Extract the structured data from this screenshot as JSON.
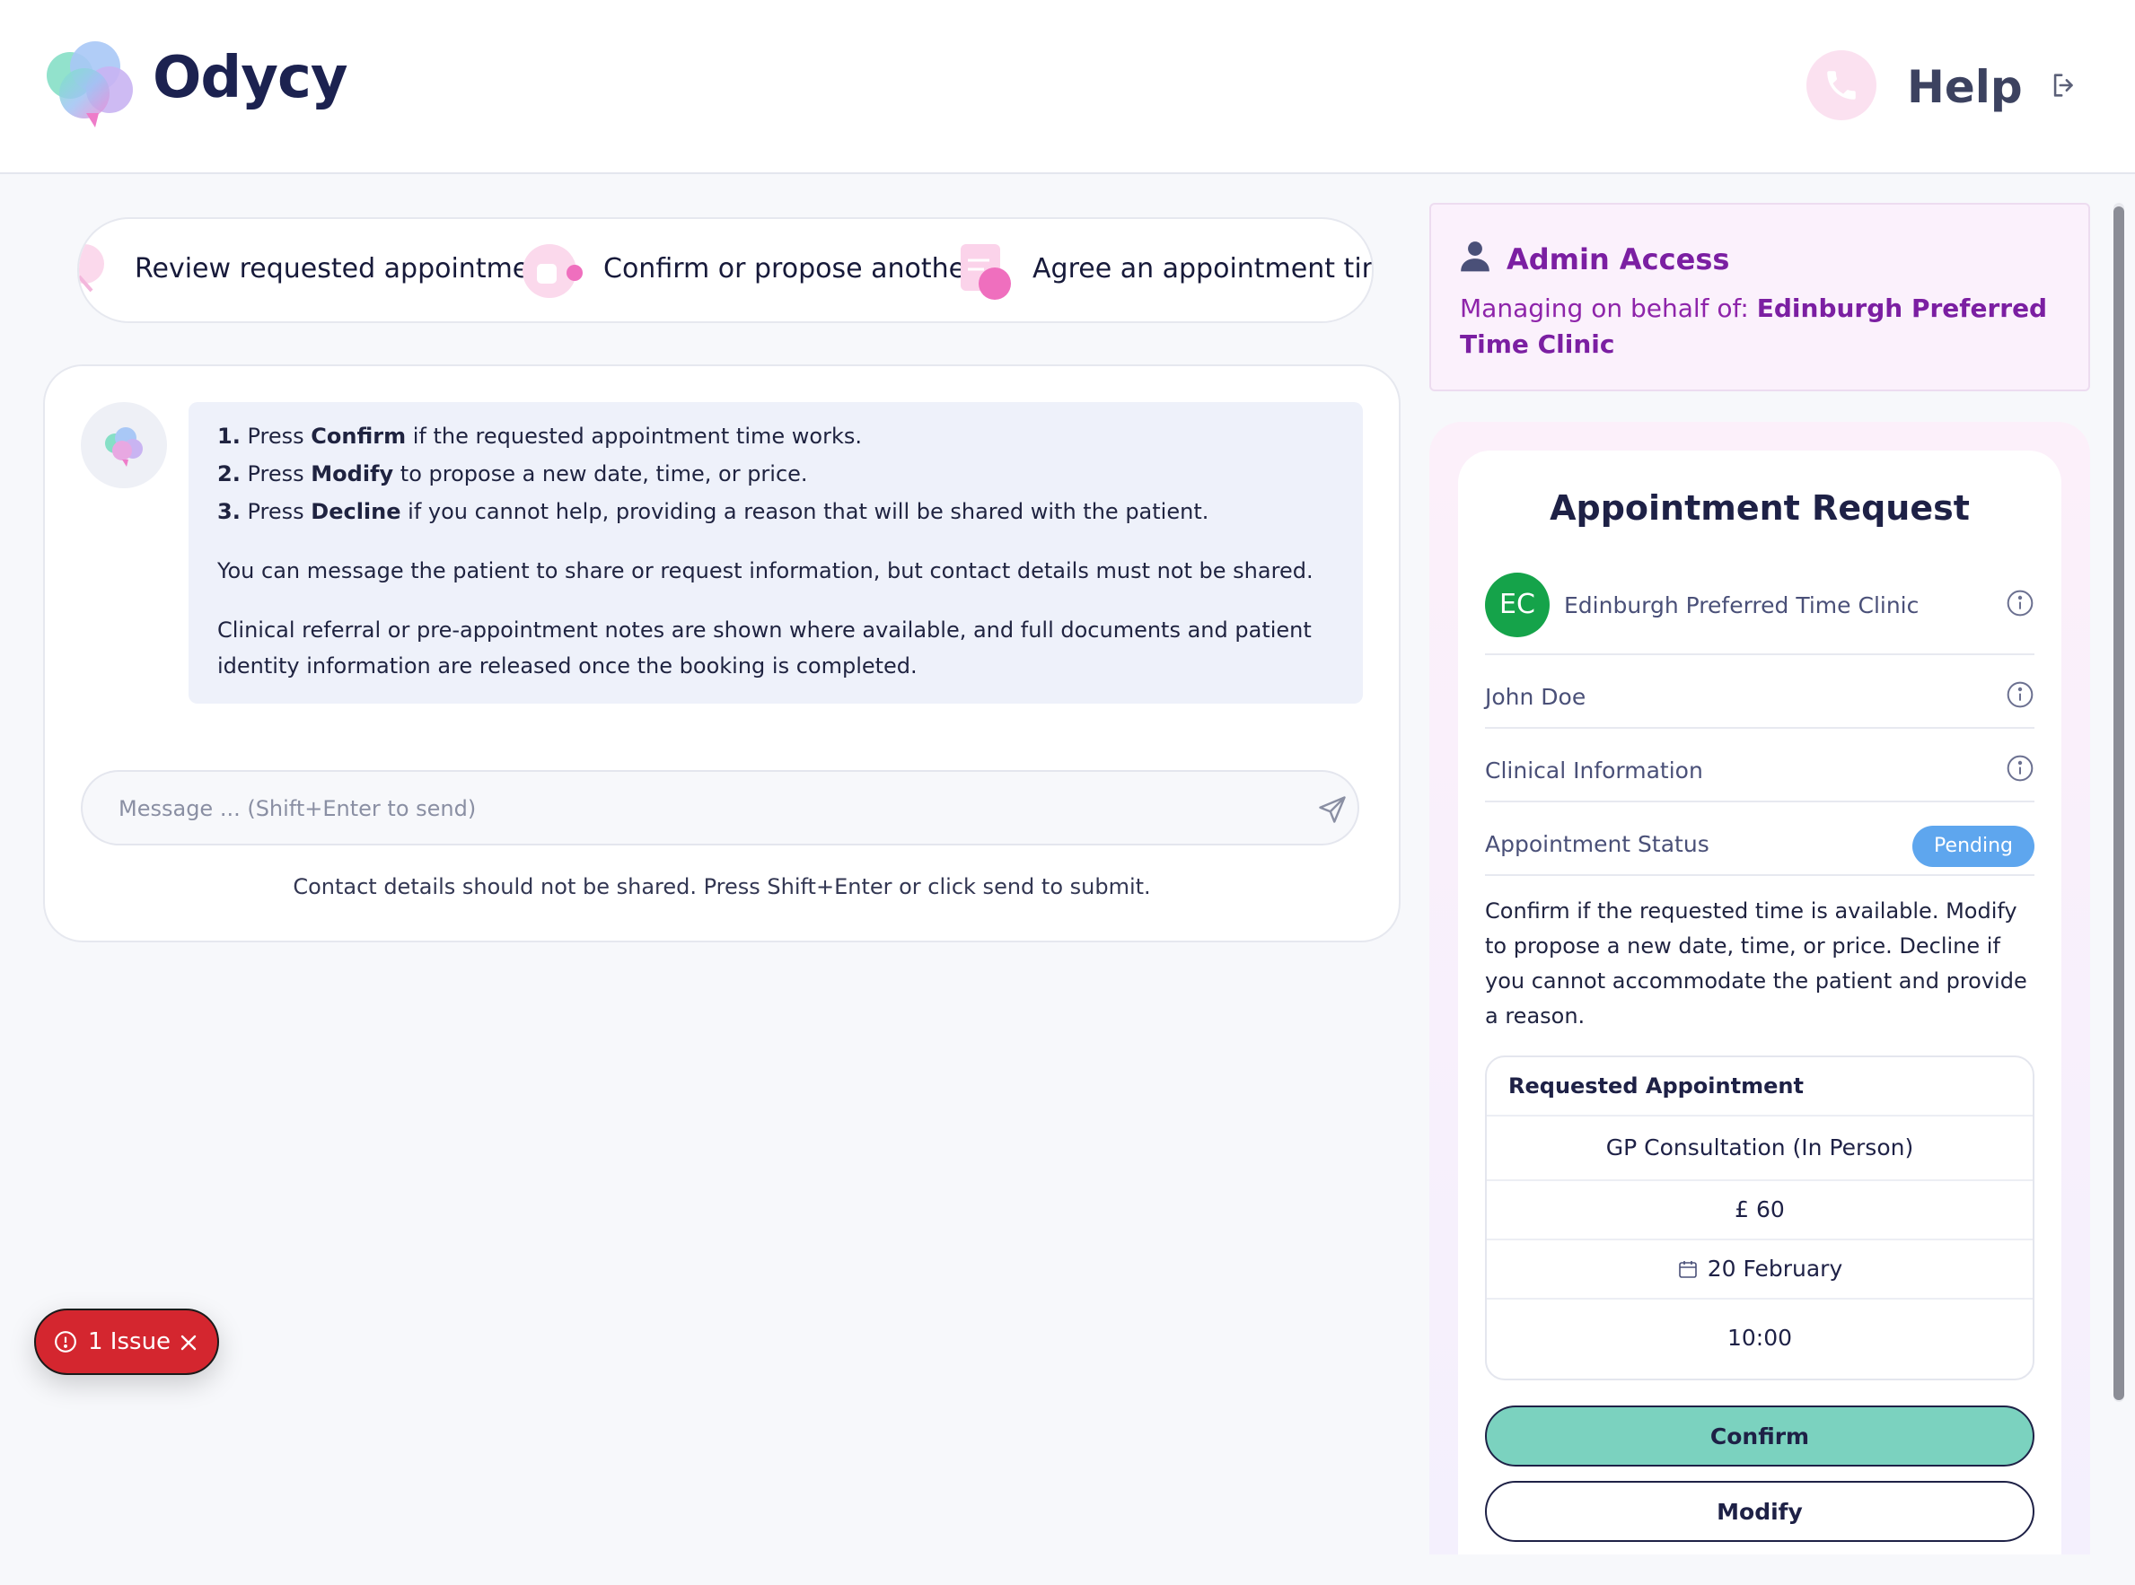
{
  "header": {
    "brand": "Odycy",
    "help_label": "Help",
    "icons": [
      "odycy-logo-icon",
      "phone-icon",
      "logout-icon"
    ]
  },
  "steps": [
    {
      "label": "Review requested appointment.",
      "icon": "magnifier-icon"
    },
    {
      "label": "Confirm or propose another.",
      "icon": "thumbs-up-icon"
    },
    {
      "label": "Agree an appointment time and",
      "icon": "clipboard-icon"
    }
  ],
  "chat": {
    "instructions": [
      {
        "num": "1.",
        "pre": "Press",
        "bold": "Confirm",
        "post": "if the requested appointment time works."
      },
      {
        "num": "2.",
        "pre": "Press",
        "bold": "Modify",
        "post": "to propose a new date, time, or price."
      },
      {
        "num": "3.",
        "pre": "Press",
        "bold": "Decline",
        "post": "if you cannot help, providing a reason that will be shared with the patient."
      }
    ],
    "paragraph_1": "You can message the patient to share or request information, but contact details must not be shared.",
    "paragraph_2": "Clinical referral or pre-appointment notes are shown where available, and full documents and patient identity information are released once the booking is completed.",
    "message_placeholder": "Message ... (Shift+Enter to send)",
    "hint": "Contact details should not be shared. Press Shift+Enter or click send to submit."
  },
  "issue_badge": {
    "label": "1 Issue",
    "color": "#d4262f"
  },
  "admin": {
    "title": "Admin Access",
    "prefix": "Managing on behalf of:",
    "clinic": "Edinburgh Preferred Time Clinic"
  },
  "request": {
    "title": "Appointment Request",
    "clinic_initials": "EC",
    "clinic_name": "Edinburgh Preferred Time Clinic",
    "patient_name": "John Doe",
    "clinical_info_label": "Clinical Information",
    "status_label": "Appointment Status",
    "status_value": "Pending",
    "description": "Confirm if the requested time is available. Modify to propose a new date, time, or price. Decline if you cannot accommodate the patient and provide a reason.",
    "appointment": {
      "heading": "Requested Appointment",
      "service": "GP Consultation (In Person)",
      "price": "£ 60",
      "date": "20 February",
      "time": "10:00"
    },
    "buttons": {
      "confirm": "Confirm",
      "modify": "Modify"
    }
  },
  "colors": {
    "accent_teal": "#7bd2bf",
    "admin_purple": "#7b1fa2",
    "pending_blue": "#5ea6ee",
    "avatar_green": "#15a34a"
  }
}
